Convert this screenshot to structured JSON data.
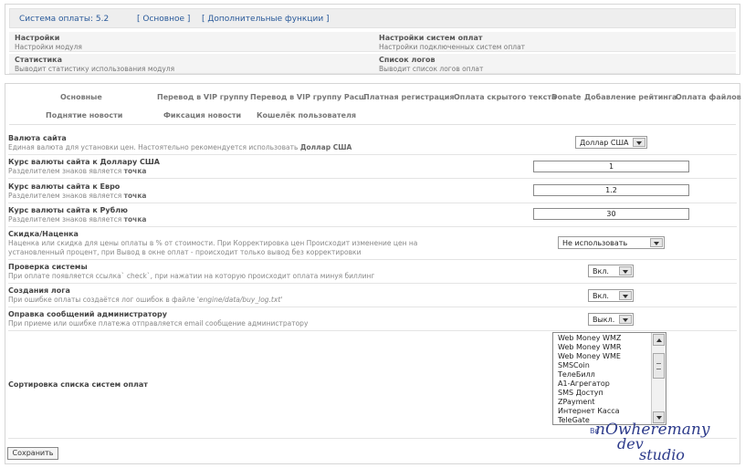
{
  "topbar": {
    "version": "Система оплаты: 5.2",
    "tab_main": "[ Основное ]",
    "tab_extra": "[ Дополнительные функции ]"
  },
  "modules": [
    {
      "title": "Настройки",
      "desc": "Настройки модуля"
    },
    {
      "title": "Настройки систем оплат",
      "desc": "Настройки подключенных систем оплат"
    },
    {
      "title": "Статистика",
      "desc": "Выводит статистику использования модуля"
    },
    {
      "title": "Список логов",
      "desc": "Выводит список логов оплат"
    }
  ],
  "tabs": [
    "Основные",
    "Перевод в VIP группу",
    "Перевод в VIP группу Расш",
    "Платная регистрация",
    "Оплата скрытого текста",
    "Donate",
    "Добавление рейтинга",
    "Оплата файлов",
    "Поднятие новости",
    "Фиксация новости",
    "Кошелёк пользователя"
  ],
  "settings": {
    "currency": {
      "title": "Валюта сайта",
      "desc": "Единая валюта для установки цен. Настоятельно рекомендуется использовать",
      "desc_bold": "Доллар США",
      "value": "Доллар США"
    },
    "rate_usd": {
      "title": "Курс валюты сайта к Доллару США",
      "desc": "Разделителем знаков является",
      "desc_bold": "точка",
      "value": "1"
    },
    "rate_eur": {
      "title": "Курс валюты сайта к Евро",
      "desc": "Разделителем знаков является",
      "desc_bold": "точка",
      "value": "1.2"
    },
    "rate_rub": {
      "title": "Курс валюты сайта к Рублю",
      "desc": "Разделителем знаков является",
      "desc_bold": "точка",
      "value": "30"
    },
    "discount": {
      "title": "Скидка/Наценка",
      "desc": "Наценка или скидка для цены оплаты в % от стоимости. При Корректировка цен Происходит изменение цен на установленный процент, при Вывод в окне оплат - происходит только вывод без корректировки",
      "value": "Не использовать"
    },
    "check": {
      "title": "Проверка системы",
      "desc": "При оплате появляется ссылка` check`, при нажатии на которую происходит оплата минуя биллинг",
      "value": "Вкл."
    },
    "log": {
      "title": "Создания лога",
      "desc": "При ошибке оплаты создаётся лог ошибок в файле",
      "desc_italic": "'engine/data/buy_log.txt'",
      "value": "Вкл."
    },
    "notify": {
      "title": "Оправка сообщений администратору",
      "desc": "При приеме или ошибке платежа отправляется email сообщение администратору",
      "value": "Выкл."
    },
    "sort": {
      "title": "Сортировка списка систем оплат",
      "items": [
        "Web Money WMZ",
        "Web Money WMR",
        "Web Money WME",
        "SMSCoin",
        "ТелеБилл",
        "A1-Агрегатор",
        "SMS Доступ",
        "ZPayment",
        "Интернет Касса",
        "TeleGate"
      ],
      "hidden_text": "Вв"
    }
  },
  "save_label": "Сохранить",
  "watermark": {
    "line1": "nOwheremany",
    "line2": "dev",
    "line3": "studio"
  }
}
